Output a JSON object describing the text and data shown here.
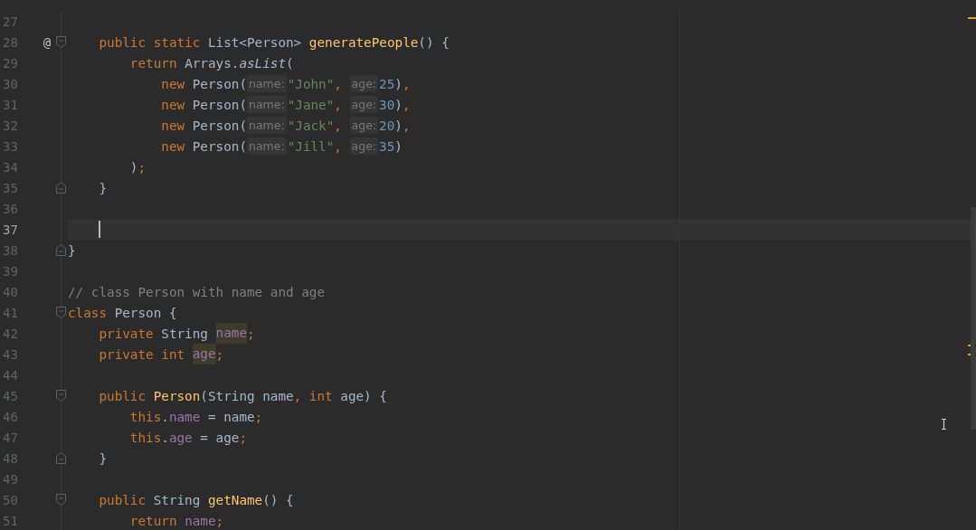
{
  "editor": {
    "lines": [
      {
        "number": "27",
        "current": false,
        "fold_start": false,
        "fold_end": false
      },
      {
        "number": "28",
        "current": false,
        "gutter_mark": "@",
        "fold_start": true,
        "fold_end": false,
        "tokens": [
          {
            "kind": "kw",
            "text": "    public static "
          },
          {
            "kind": "plain",
            "text": "List<Person> "
          },
          {
            "kind": "fn",
            "text": "generatePeople"
          },
          {
            "kind": "plain",
            "text": "() {"
          }
        ]
      },
      {
        "number": "29",
        "current": false,
        "fold_start": false,
        "fold_end": false,
        "tokens": [
          {
            "kind": "kw",
            "text": "        return "
          },
          {
            "kind": "plain",
            "text": "Arrays."
          },
          {
            "kind": "static",
            "text": "asList"
          },
          {
            "kind": "plain",
            "text": "("
          }
        ]
      },
      {
        "number": "30",
        "current": false,
        "fold_start": false,
        "fold_end": false,
        "tokens": [
          {
            "kind": "kw",
            "text": "            new "
          },
          {
            "kind": "plain",
            "text": "Person("
          },
          {
            "kind": "hint",
            "text": "name:"
          },
          {
            "kind": "str",
            "text": "\"John\""
          },
          {
            "kind": "punct",
            "text": ", "
          },
          {
            "kind": "hint",
            "text": "age:"
          },
          {
            "kind": "num",
            "text": "25"
          },
          {
            "kind": "plain",
            "text": ")"
          },
          {
            "kind": "punct",
            "text": ","
          }
        ]
      },
      {
        "number": "31",
        "current": false,
        "fold_start": false,
        "fold_end": false,
        "tokens": [
          {
            "kind": "kw",
            "text": "            new "
          },
          {
            "kind": "plain",
            "text": "Person("
          },
          {
            "kind": "hint",
            "text": "name:"
          },
          {
            "kind": "str",
            "text": "\"Jane\""
          },
          {
            "kind": "punct",
            "text": ", "
          },
          {
            "kind": "hint",
            "text": "age:"
          },
          {
            "kind": "num",
            "text": "30"
          },
          {
            "kind": "plain",
            "text": ")"
          },
          {
            "kind": "punct",
            "text": ","
          }
        ]
      },
      {
        "number": "32",
        "current": false,
        "fold_start": false,
        "fold_end": false,
        "tokens": [
          {
            "kind": "kw",
            "text": "            new "
          },
          {
            "kind": "plain",
            "text": "Person("
          },
          {
            "kind": "hint",
            "text": "name:"
          },
          {
            "kind": "str",
            "text": "\"Jack\""
          },
          {
            "kind": "punct",
            "text": ", "
          },
          {
            "kind": "hint",
            "text": "age:"
          },
          {
            "kind": "num",
            "text": "20"
          },
          {
            "kind": "plain",
            "text": ")"
          },
          {
            "kind": "punct",
            "text": ","
          }
        ]
      },
      {
        "number": "33",
        "current": false,
        "fold_start": false,
        "fold_end": false,
        "tokens": [
          {
            "kind": "kw",
            "text": "            new "
          },
          {
            "kind": "plain",
            "text": "Person("
          },
          {
            "kind": "hint",
            "text": "name:"
          },
          {
            "kind": "str",
            "text": "\"Jill\""
          },
          {
            "kind": "punct",
            "text": ", "
          },
          {
            "kind": "hint",
            "text": "age:"
          },
          {
            "kind": "num",
            "text": "35"
          },
          {
            "kind": "plain",
            "text": ")"
          }
        ]
      },
      {
        "number": "34",
        "current": false,
        "fold_start": false,
        "fold_end": false,
        "tokens": [
          {
            "kind": "plain",
            "text": "        )"
          },
          {
            "kind": "punct",
            "text": ";"
          }
        ]
      },
      {
        "number": "35",
        "current": false,
        "fold_start": false,
        "fold_end": true,
        "tokens": [
          {
            "kind": "plain",
            "text": "    }"
          }
        ]
      },
      {
        "number": "36",
        "current": false,
        "fold_start": false,
        "fold_end": false
      },
      {
        "number": "37",
        "current": true,
        "fold_start": false,
        "fold_end": false
      },
      {
        "number": "38",
        "current": false,
        "fold_start": false,
        "fold_end": true,
        "tokens": [
          {
            "kind": "plain",
            "text": "}"
          }
        ]
      },
      {
        "number": "39",
        "current": false,
        "fold_start": false,
        "fold_end": false
      },
      {
        "number": "40",
        "current": false,
        "fold_start": false,
        "fold_end": false,
        "tokens": [
          {
            "kind": "comment",
            "text": "// class Person with name and age"
          }
        ]
      },
      {
        "number": "41",
        "current": false,
        "fold_start": true,
        "fold_end": false,
        "tokens": [
          {
            "kind": "kw",
            "text": "class "
          },
          {
            "kind": "plain",
            "text": "Person {"
          }
        ]
      },
      {
        "number": "42",
        "current": false,
        "fold_start": false,
        "fold_end": false,
        "tokens": [
          {
            "kind": "kw",
            "text": "    private "
          },
          {
            "kind": "plain",
            "text": "String "
          },
          {
            "kind": "usage",
            "text": "name"
          },
          {
            "kind": "punct",
            "text": ";"
          }
        ]
      },
      {
        "number": "43",
        "current": false,
        "fold_start": false,
        "fold_end": false,
        "tokens": [
          {
            "kind": "kw",
            "text": "    private int "
          },
          {
            "kind": "usage",
            "text": "age"
          },
          {
            "kind": "punct",
            "text": ";"
          }
        ]
      },
      {
        "number": "44",
        "current": false,
        "fold_start": false,
        "fold_end": false
      },
      {
        "number": "45",
        "current": false,
        "fold_start": true,
        "fold_end": false,
        "tokens": [
          {
            "kind": "kw",
            "text": "    public "
          },
          {
            "kind": "fn",
            "text": "Person"
          },
          {
            "kind": "plain",
            "text": "(String name"
          },
          {
            "kind": "punct",
            "text": ", "
          },
          {
            "kind": "kw",
            "text": "int "
          },
          {
            "kind": "plain",
            "text": "age) {"
          }
        ]
      },
      {
        "number": "46",
        "current": false,
        "fold_start": false,
        "fold_end": false,
        "tokens": [
          {
            "kind": "kw",
            "text": "        this"
          },
          {
            "kind": "plain",
            "text": "."
          },
          {
            "kind": "field",
            "text": "name"
          },
          {
            "kind": "plain",
            "text": " = name"
          },
          {
            "kind": "punct",
            "text": ";"
          }
        ]
      },
      {
        "number": "47",
        "current": false,
        "fold_start": false,
        "fold_end": false,
        "tokens": [
          {
            "kind": "kw",
            "text": "        this"
          },
          {
            "kind": "plain",
            "text": "."
          },
          {
            "kind": "field",
            "text": "age"
          },
          {
            "kind": "plain",
            "text": " = age"
          },
          {
            "kind": "punct",
            "text": ";"
          }
        ]
      },
      {
        "number": "48",
        "current": false,
        "fold_start": false,
        "fold_end": true,
        "tokens": [
          {
            "kind": "plain",
            "text": "    }"
          }
        ]
      },
      {
        "number": "49",
        "current": false,
        "fold_start": false,
        "fold_end": false
      },
      {
        "number": "50",
        "current": false,
        "fold_start": true,
        "fold_end": false,
        "tokens": [
          {
            "kind": "kw",
            "text": "    public "
          },
          {
            "kind": "plain",
            "text": "String "
          },
          {
            "kind": "fn",
            "text": "getName"
          },
          {
            "kind": "plain",
            "text": "() {"
          }
        ]
      },
      {
        "number": "51",
        "current": false,
        "fold_start": false,
        "fold_end": false,
        "tokens": [
          {
            "kind": "kw",
            "text": "        return "
          },
          {
            "kind": "field",
            "text": "name"
          },
          {
            "kind": "punct",
            "text": ";"
          }
        ]
      }
    ]
  }
}
